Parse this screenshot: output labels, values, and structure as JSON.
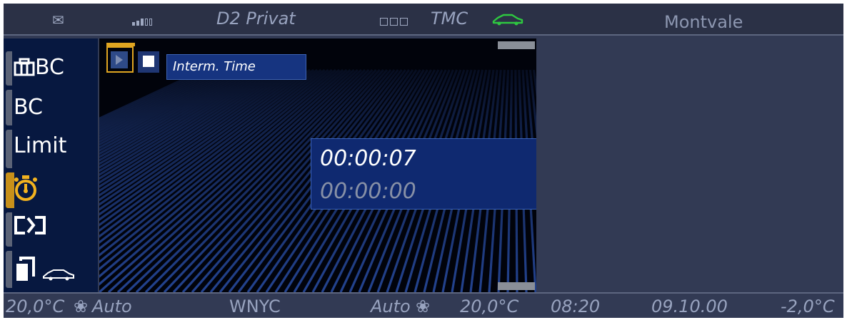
{
  "top_bar": {
    "mail_icon": "envelope-icon",
    "signal_strength": 3,
    "signal_max": 5,
    "network": "D2 Privat",
    "tmc_label": "TMC",
    "tmc_icon": "car-outline-icon",
    "tmc_color": "#2ec840",
    "location": "Montvale"
  },
  "sidebar": {
    "items": [
      {
        "icon": "briefcase-icon",
        "label": "BC"
      },
      {
        "label": "BC"
      },
      {
        "label": "Limit"
      },
      {
        "icon": "stopwatch-icon",
        "active": true
      },
      {
        "icon": "swap-arrow-icon"
      },
      {
        "icon": "copy-car-icon"
      }
    ],
    "active_color": "#f2b21f"
  },
  "stopwatch": {
    "mode_label": "Interm. Time",
    "current_time": "00:00:07",
    "saved_time": "00:00:00"
  },
  "bottom_bar": {
    "temp_left": "20,0°C",
    "fan_left": "Auto",
    "station": "WNYC",
    "fan_right": "Auto",
    "temp_right": "20,0°C",
    "time": "08:20",
    "date": "09.10.00",
    "outside_temp": "-2,0°C"
  }
}
